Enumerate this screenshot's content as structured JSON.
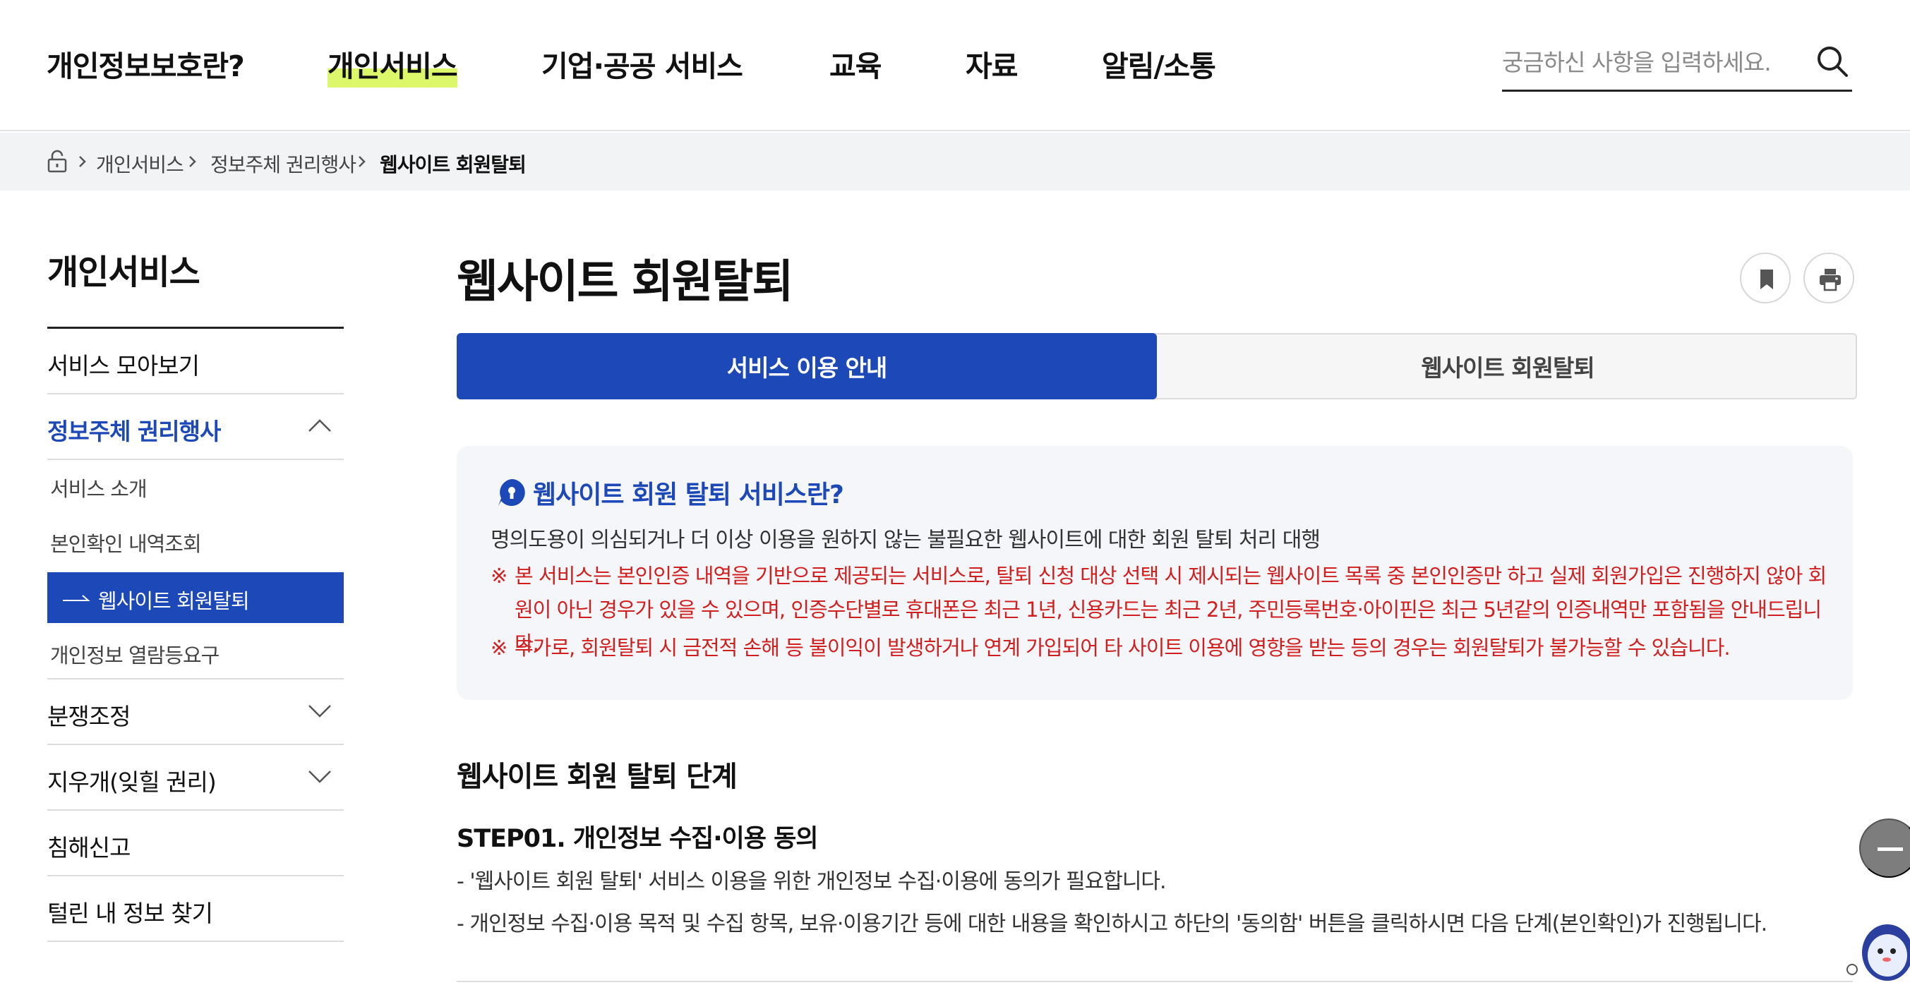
{
  "nav": {
    "items": [
      {
        "label": "개인정보보호란?"
      },
      {
        "label": "개인서비스"
      },
      {
        "label": "기업·공공 서비스"
      },
      {
        "label": "교육"
      },
      {
        "label": "자료"
      },
      {
        "label": "알림/소통"
      }
    ],
    "active_index": 1,
    "search_placeholder": "궁금하신 사항을 입력하세요."
  },
  "breadcrumb": {
    "items": [
      "개인서비스",
      "정보주체 권리행사",
      "웹사이트 회원탈퇴"
    ]
  },
  "sidebar": {
    "title": "개인서비스",
    "items": [
      {
        "label": "서비스 모아보기"
      },
      {
        "label": "정보주체 권리행사",
        "state": "open"
      },
      {
        "label": "분쟁조정",
        "state": "collapsed"
      },
      {
        "label": "지우개(잊힐 권리)",
        "state": "collapsed"
      },
      {
        "label": "침해신고"
      },
      {
        "label": "털린 내 정보 찾기"
      }
    ],
    "subitems": [
      {
        "label": "서비스 소개"
      },
      {
        "label": "본인확인 내역조회"
      },
      {
        "label": "웹사이트 회원탈퇴",
        "active": true
      },
      {
        "label": "개인정보 열람등요구"
      }
    ]
  },
  "main": {
    "title": "웹사이트 회원탈퇴",
    "tabs": [
      {
        "label": "서비스 이용 안내",
        "active": true
      },
      {
        "label": "웹사이트 회원탈퇴",
        "active": false
      }
    ],
    "info": {
      "title": "웹사이트 회원 탈퇴 서비스란?",
      "desc": "명의도용이 의심되거나 더 이상 이용을 원하지 않는 불필요한 웹사이트에 대한 회원 탈퇴 처리 대행",
      "note_mark": "※",
      "notes": [
        "본 서비스는 본인인증 내역을 기반으로 제공되는 서비스로, 탈퇴 신청 대상 선택 시 제시되는 웹사이트 목록 중 본인인증만 하고 실제 회원가입은 진행하지 않아 회원이 아닌 경우가 있을 수 있으며, 인증수단별로 휴대폰은 최근 1년, 신용카드는 최근 2년, 주민등록번호·아이핀은 최근 5년같의 인증내역만 포함됨을 안내드립니다.",
        "추가로, 회원탈퇴 시 금전적 손해 등 불이익이 발생하거나 연계 가입되어 타 사이트 이용에 영향을 받는 등의 경우는 회원탈퇴가 불가능할 수 있습니다."
      ]
    },
    "section_title": "웹사이트 회원 탈퇴 단계",
    "step": {
      "title": "STEP01. 개인정보 수집·이용 동의",
      "lines": [
        "- '웹사이트 회원 탈퇴' 서비스 이용을 위한 개인정보 수집·이용에 동의가 필요합니다.",
        "- 개인정보 수집·이용 목적 및 수집 항목, 보유·이용기간 등에 대한 내용을 확인하시고 하단의 '동의함' 버튼을 클릭하시면 다음 단계(본인확인)가 진행됩니다."
      ]
    }
  },
  "colors": {
    "accent": "#1d48b8",
    "highlight": "#dcf76a",
    "warning": "#d11f1f",
    "info_bg": "#f4f6f9"
  },
  "icons": [
    "search-icon",
    "home-icon",
    "chevron-right-icon",
    "chevron-up-icon",
    "chevron-down-icon",
    "arrow-right-icon",
    "bookmark-icon",
    "print-icon",
    "speech-bubble-icon",
    "minus-icon",
    "mascot-icon"
  ]
}
